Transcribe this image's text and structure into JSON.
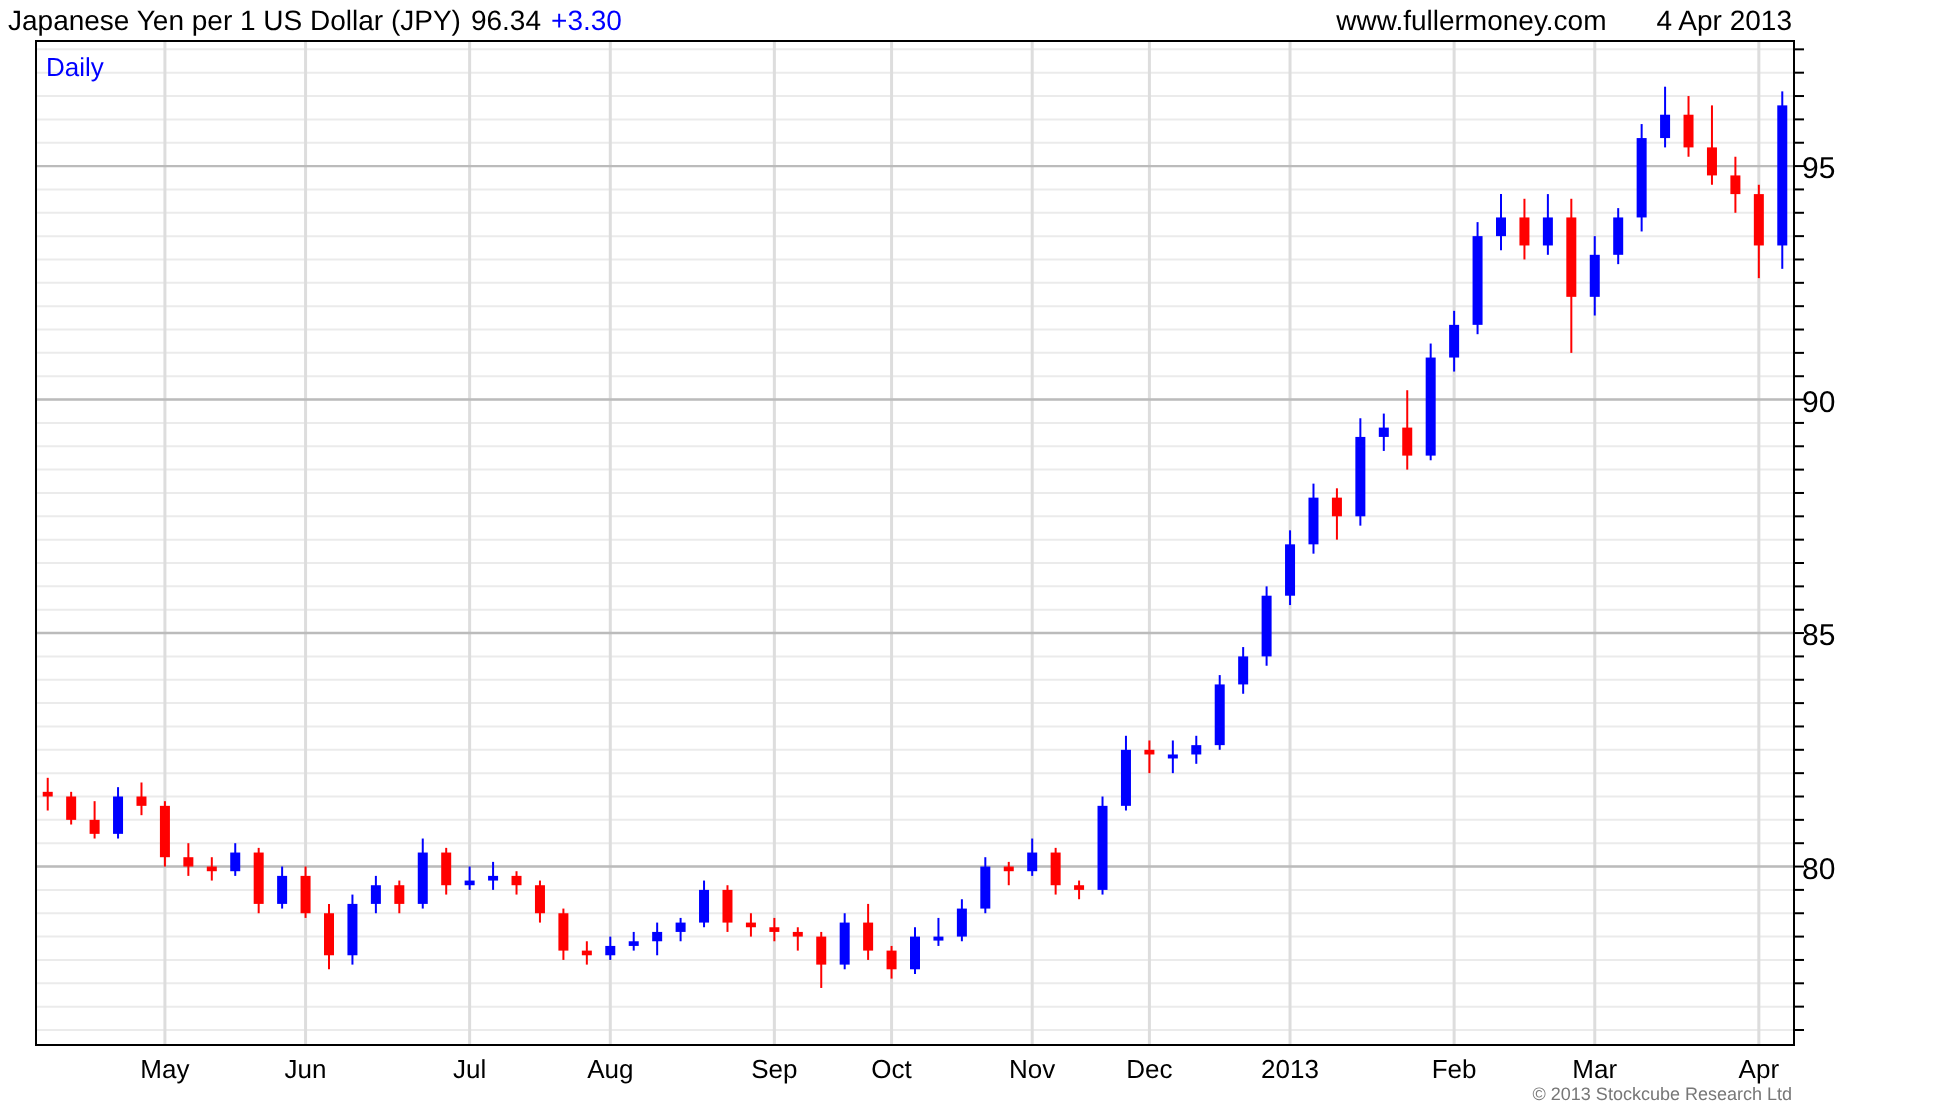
{
  "header": {
    "title": "Japanese Yen per 1 US Dollar (JPY)",
    "price": "96.34",
    "change": "+3.30",
    "site": "www.fullermoney.com",
    "date": "4 Apr 2013"
  },
  "chart": {
    "period_label": "Daily",
    "chart_data": {
      "type": "candlestick",
      "categories": [
        null,
        null,
        null,
        null,
        null,
        "May",
        null,
        null,
        null,
        null,
        null,
        "Jun",
        null,
        null,
        null,
        null,
        null,
        null,
        "Jul",
        null,
        null,
        null,
        null,
        null,
        "Aug",
        null,
        null,
        null,
        null,
        null,
        null,
        "Sep",
        null,
        null,
        null,
        null,
        "Oct",
        null,
        null,
        null,
        null,
        null,
        "Nov",
        null,
        null,
        null,
        null,
        "Dec",
        null,
        null,
        null,
        null,
        null,
        "2013",
        null,
        null,
        null,
        null,
        null,
        null,
        "Feb",
        null,
        null,
        null,
        null,
        null,
        "Mar",
        null,
        null,
        null,
        null,
        null,
        null,
        "Apr",
        null
      ],
      "ohlc": [
        [
          81.6,
          81.9,
          81.2,
          81.5
        ],
        [
          81.5,
          81.6,
          80.9,
          81.0
        ],
        [
          81.0,
          81.4,
          80.6,
          80.7
        ],
        [
          80.7,
          81.7,
          80.6,
          81.5
        ],
        [
          81.5,
          81.8,
          81.1,
          81.3
        ],
        [
          81.3,
          81.4,
          80.0,
          80.2
        ],
        [
          80.2,
          80.5,
          79.8,
          80.0
        ],
        [
          80.0,
          80.2,
          79.7,
          79.9
        ],
        [
          79.9,
          80.5,
          79.8,
          80.3
        ],
        [
          80.3,
          80.4,
          79.0,
          79.2
        ],
        [
          79.2,
          80.0,
          79.1,
          79.8
        ],
        [
          79.8,
          80.0,
          78.9,
          79.0
        ],
        [
          79.0,
          79.2,
          77.8,
          78.1
        ],
        [
          78.1,
          79.4,
          77.9,
          79.2
        ],
        [
          79.2,
          79.8,
          79.0,
          79.6
        ],
        [
          79.6,
          79.7,
          79.0,
          79.2
        ],
        [
          79.2,
          80.6,
          79.1,
          80.3
        ],
        [
          80.3,
          80.4,
          79.4,
          79.6
        ],
        [
          79.6,
          80.0,
          79.5,
          79.7
        ],
        [
          79.7,
          80.1,
          79.5,
          79.8
        ],
        [
          79.8,
          79.9,
          79.4,
          79.6
        ],
        [
          79.6,
          79.7,
          78.8,
          79.0
        ],
        [
          79.0,
          79.1,
          78.0,
          78.2
        ],
        [
          78.2,
          78.4,
          77.9,
          78.1
        ],
        [
          78.1,
          78.5,
          78.0,
          78.3
        ],
        [
          78.3,
          78.6,
          78.2,
          78.4
        ],
        [
          78.4,
          78.8,
          78.1,
          78.6
        ],
        [
          78.6,
          78.9,
          78.4,
          78.8
        ],
        [
          78.8,
          79.7,
          78.7,
          79.5
        ],
        [
          79.5,
          79.6,
          78.6,
          78.8
        ],
        [
          78.8,
          79.0,
          78.5,
          78.7
        ],
        [
          78.7,
          78.9,
          78.4,
          78.6
        ],
        [
          78.6,
          78.7,
          78.2,
          78.5
        ],
        [
          78.5,
          78.6,
          77.4,
          77.9
        ],
        [
          77.9,
          79.0,
          77.8,
          78.8
        ],
        [
          78.8,
          79.2,
          78.0,
          78.2
        ],
        [
          78.2,
          78.3,
          77.6,
          77.8
        ],
        [
          77.8,
          78.7,
          77.7,
          78.5
        ],
        [
          78.5,
          78.9,
          78.3,
          78.5
        ],
        [
          78.5,
          79.3,
          78.4,
          79.1
        ],
        [
          79.1,
          80.2,
          79.0,
          80.0
        ],
        [
          80.0,
          80.1,
          79.6,
          79.9
        ],
        [
          79.9,
          80.6,
          79.8,
          80.3
        ],
        [
          80.3,
          80.4,
          79.4,
          79.6
        ],
        [
          79.6,
          79.7,
          79.3,
          79.5
        ],
        [
          79.5,
          81.5,
          79.4,
          81.3
        ],
        [
          81.3,
          82.8,
          81.2,
          82.5
        ],
        [
          82.5,
          82.7,
          82.0,
          82.4
        ],
        [
          82.4,
          82.7,
          82.0,
          82.4
        ],
        [
          82.4,
          82.8,
          82.2,
          82.6
        ],
        [
          82.6,
          84.1,
          82.5,
          83.9
        ],
        [
          83.9,
          84.7,
          83.7,
          84.5
        ],
        [
          84.5,
          86.0,
          84.3,
          85.8
        ],
        [
          85.8,
          87.2,
          85.6,
          86.9
        ],
        [
          86.9,
          88.2,
          86.7,
          87.9
        ],
        [
          87.9,
          88.1,
          87.0,
          87.5
        ],
        [
          87.5,
          89.6,
          87.3,
          89.2
        ],
        [
          89.2,
          89.7,
          88.9,
          89.4
        ],
        [
          89.4,
          90.2,
          88.5,
          88.8
        ],
        [
          88.8,
          91.2,
          88.7,
          90.9
        ],
        [
          90.9,
          91.9,
          90.6,
          91.6
        ],
        [
          91.6,
          93.8,
          91.4,
          93.5
        ],
        [
          93.5,
          94.4,
          93.2,
          93.9
        ],
        [
          93.9,
          94.3,
          93.0,
          93.3
        ],
        [
          93.3,
          94.4,
          93.1,
          93.9
        ],
        [
          93.9,
          94.3,
          91.0,
          92.2
        ],
        [
          92.2,
          93.5,
          91.8,
          93.1
        ],
        [
          93.1,
          94.1,
          92.9,
          93.9
        ],
        [
          93.9,
          95.9,
          93.6,
          95.6
        ],
        [
          95.6,
          96.7,
          95.4,
          96.1
        ],
        [
          96.1,
          96.5,
          95.2,
          95.4
        ],
        [
          95.4,
          96.3,
          94.6,
          94.8
        ],
        [
          94.8,
          95.2,
          94.0,
          94.4
        ],
        [
          94.4,
          94.6,
          92.6,
          93.3
        ],
        [
          93.3,
          96.6,
          92.8,
          96.3
        ]
      ],
      "ylim": [
        76.2,
        97.7
      ],
      "grid": true,
      "yticks": [
        80,
        85,
        90,
        95
      ]
    }
  },
  "footer": {
    "copyright": "© 2013 Stockcube Research Ltd"
  }
}
